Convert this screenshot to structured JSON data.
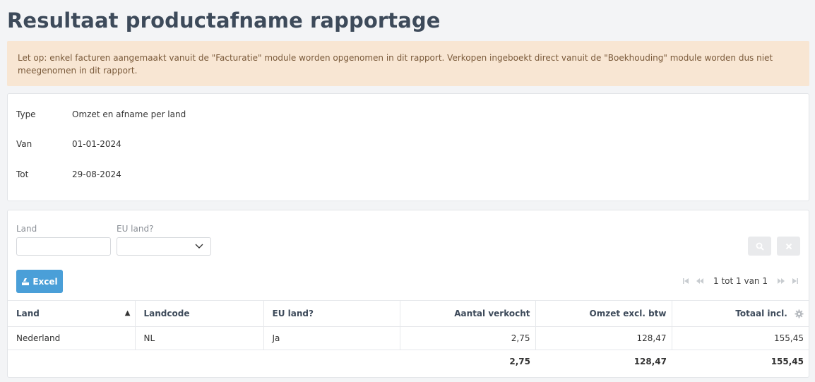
{
  "page": {
    "title": "Resultaat productafname rapportage",
    "alert": "Let op: enkel facturen aangemaakt vanuit de \"Facturatie\" module worden opgenomen in dit rapport. Verkopen ingeboekt direct vanuit de \"Boekhouding\" module worden dus niet meegenomen in dit rapport."
  },
  "info": [
    {
      "label": "Type",
      "value": "Omzet en afname per land"
    },
    {
      "label": "Van",
      "value": "01-01-2024"
    },
    {
      "label": "Tot",
      "value": "29-08-2024"
    }
  ],
  "filters": {
    "land_label": "Land",
    "land_value": "",
    "eu_label": "EU land?",
    "eu_value": ""
  },
  "toolbar": {
    "excel_label": "Excel",
    "pager_text": "1 tot 1 van 1"
  },
  "table": {
    "headers": [
      "Land",
      "Landcode",
      "EU land?",
      "Aantal verkocht",
      "Omzet excl. btw",
      "Totaal incl."
    ],
    "rows": [
      [
        "Nederland",
        "NL",
        "Ja",
        "2,75",
        "128,47",
        "155,45"
      ]
    ],
    "totals": [
      "",
      "",
      "",
      "2,75",
      "128,47",
      "155,45"
    ]
  },
  "icons": {
    "search": "search-icon",
    "clear": "close-icon",
    "excel": "excel-export-icon",
    "settings": "gear-icon"
  },
  "colors": {
    "title": "#3d4a5a",
    "alert_bg": "#f8e6d3",
    "alert_text": "#7a5a3a",
    "primary": "#4a9fd8"
  }
}
